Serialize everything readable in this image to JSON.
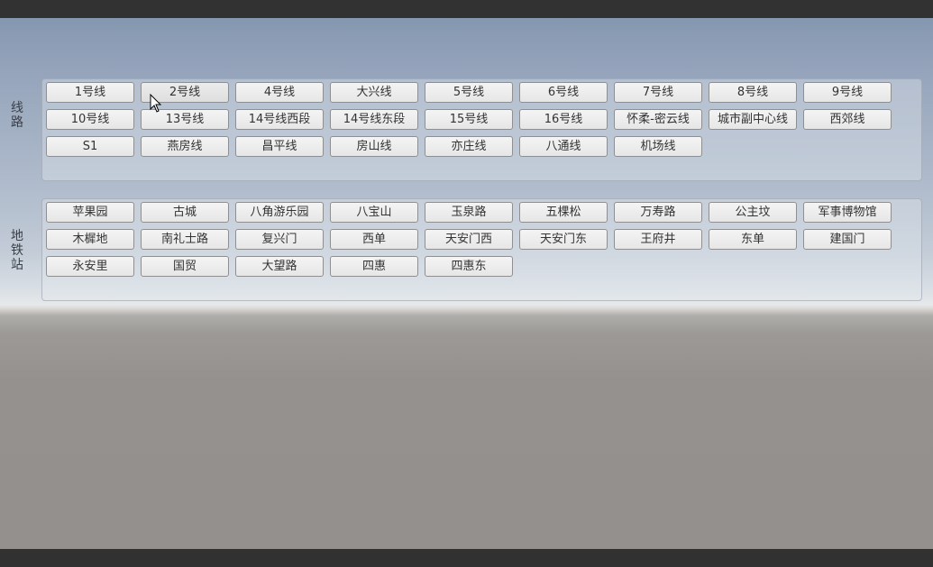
{
  "lines": {
    "label": "线路",
    "items": [
      "1号线",
      "2号线",
      "4号线",
      "大兴线",
      "5号线",
      "6号线",
      "7号线",
      "8号线",
      "9号线",
      "10号线",
      "13号线",
      "14号线西段",
      "14号线东段",
      "15号线",
      "16号线",
      "怀柔-密云线",
      "城市副中心线",
      "西郊线",
      "S1",
      "燕房线",
      "昌平线",
      "房山线",
      "亦庄线",
      "八通线",
      "机场线"
    ]
  },
  "stations": {
    "label": "地铁站",
    "items": [
      "苹果园",
      "古城",
      "八角游乐园",
      "八宝山",
      "玉泉路",
      "五棵松",
      "万寿路",
      "公主坟",
      "军事博物馆",
      "木樨地",
      "南礼士路",
      "复兴门",
      "西单",
      "天安门西",
      "天安门东",
      "王府井",
      "东单",
      "建国门",
      "永安里",
      "国贸",
      "大望路",
      "四惠",
      "四惠东"
    ]
  },
  "hovered_line": "2号线"
}
